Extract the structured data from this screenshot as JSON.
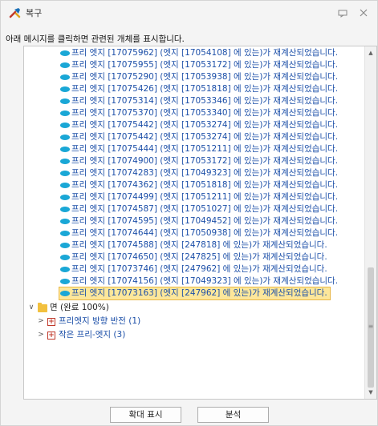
{
  "window": {
    "title": "복구",
    "icons": {
      "app": "repair-tool-icon",
      "restore": "restore-icon",
      "close": "close-icon"
    }
  },
  "instruction": "아래 메시지를 클릭하면 관련된 개체를 표시합니다.",
  "messages": [
    "프리 엣지 [17075962] (엣지 [17054108] 에 있는)가 재계산되었습니다.",
    "프리 엣지 [17075955] (엣지 [17053172] 에 있는)가 재계산되었습니다.",
    "프리 엣지 [17075290] (엣지 [17053938] 에 있는)가 재계산되었습니다.",
    "프리 엣지 [17075426] (엣지 [17051818] 에 있는)가 재계산되었습니다.",
    "프리 엣지 [17075314] (엣지 [17053346] 에 있는)가 재계산되었습니다.",
    "프리 엣지 [17075370] (엣지 [17053340] 에 있는)가 재계산되었습니다.",
    "프리 엣지 [17075442] (엣지 [17053274] 에 있는)가 재계산되었습니다.",
    "프리 엣지 [17075442] (엣지 [17053274] 에 있는)가 재계산되었습니다.",
    "프리 엣지 [17075444] (엣지 [17051211] 에 있는)가 재계산되었습니다.",
    "프리 엣지 [17074900] (엣지 [17053172] 에 있는)가 재계산되었습니다.",
    "프리 엣지 [17074283] (엣지 [17049323] 에 있는)가 재계산되었습니다.",
    "프리 엣지 [17074362] (엣지 [17051818] 에 있는)가 재계산되었습니다.",
    "프리 엣지 [17074499] (엣지 [17051211] 에 있는)가 재계산되었습니다.",
    "프리 엣지 [17074587] (엣지 [17051027] 에 있는)가 재계산되었습니다.",
    "프리 엣지 [17074595] (엣지 [17049452] 에 있는)가 재계산되었습니다.",
    "프리 엣지 [17074644] (엣지 [17050938] 에 있는)가 재계산되었습니다.",
    "프리 엣지 [17074588] (엣지 [247818] 에 있는)가 재계산되었습니다.",
    "프리 엣지 [17074650] (엣지 [247825] 에 있는)가 재계산되었습니다.",
    "프리 엣지 [17073746] (엣지 [247962] 에 있는)가 재계산되었습니다.",
    "프리 엣지 [17074156] (엣지 [17049323] 에 있는)가 재계산되었습니다.",
    "프리 엣지 [17073163] (엣지 [247962] 에 있는)가 재계산되었습니다."
  ],
  "selected_index": 20,
  "tree": {
    "group_label": "면 (완료 100%)",
    "children": [
      "프리엣지 방향 반전 (1)",
      "작은 프리-엣지 (3)"
    ]
  },
  "buttons": {
    "zoom": "확대 표시",
    "analyze": "분석"
  },
  "colors": {
    "message_text": "#1c4fa8",
    "edge_icon": "#1aa7d6",
    "selected_bg": "#fde79a"
  }
}
